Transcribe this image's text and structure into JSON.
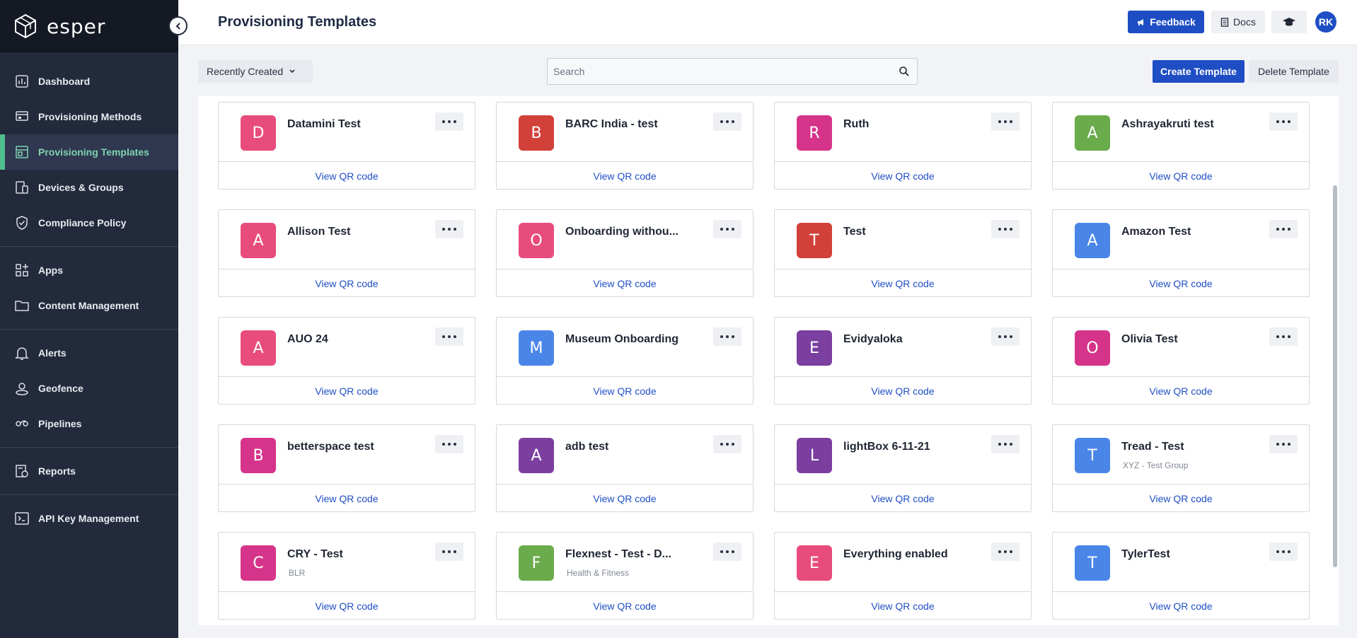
{
  "app": {
    "brand": "esper"
  },
  "sidebar": {
    "groups": [
      [
        {
          "label": "Dashboard",
          "icon": "dashboard-icon"
        },
        {
          "label": "Provisioning Methods",
          "icon": "provisioning-methods-icon"
        },
        {
          "label": "Provisioning Templates",
          "icon": "provisioning-templates-icon",
          "active": true
        },
        {
          "label": "Devices & Groups",
          "icon": "devices-icon"
        },
        {
          "label": "Compliance Policy",
          "icon": "shield-icon"
        }
      ],
      [
        {
          "label": "Apps",
          "icon": "apps-icon"
        },
        {
          "label": "Content Management",
          "icon": "folder-icon"
        }
      ],
      [
        {
          "label": "Alerts",
          "icon": "bell-icon"
        },
        {
          "label": "Geofence",
          "icon": "geofence-icon"
        },
        {
          "label": "Pipelines",
          "icon": "pipelines-icon"
        }
      ],
      [
        {
          "label": "Reports",
          "icon": "reports-icon"
        }
      ],
      [
        {
          "label": "API Key Management",
          "icon": "terminal-icon"
        }
      ]
    ]
  },
  "header": {
    "title": "Provisioning Templates",
    "feedback_label": "Feedback",
    "docs_label": "Docs",
    "avatar_initials": "RK"
  },
  "toolbar": {
    "sort_label": "Recently Created",
    "search_placeholder": "Search",
    "create_label": "Create Template",
    "delete_label": "Delete Template"
  },
  "cards": [
    {
      "letter": "D",
      "name": "Datamini Test",
      "sub": "",
      "color": "#e84c7d",
      "link": "View QR code"
    },
    {
      "letter": "B",
      "name": "BARC India - test",
      "sub": "",
      "color": "#d1413a",
      "link": "View QR code"
    },
    {
      "letter": "R",
      "name": "Ruth",
      "sub": "",
      "color": "#d6348a",
      "link": "View QR code"
    },
    {
      "letter": "A",
      "name": "Ashrayakruti test",
      "sub": "",
      "color": "#6aab4b",
      "link": "View QR code"
    },
    {
      "letter": "A",
      "name": "Allison Test",
      "sub": "",
      "color": "#e84c7d",
      "link": "View QR code"
    },
    {
      "letter": "O",
      "name": "Onboarding withou...",
      "sub": "",
      "color": "#e84c7d",
      "link": "View QR code"
    },
    {
      "letter": "T",
      "name": "Test",
      "sub": "",
      "color": "#d1413a",
      "link": "View QR code"
    },
    {
      "letter": "A",
      "name": "Amazon Test",
      "sub": "",
      "color": "#4a86e8",
      "link": "View QR code"
    },
    {
      "letter": "A",
      "name": "AUO 24",
      "sub": "",
      "color": "#e84c7d",
      "link": "View QR code"
    },
    {
      "letter": "M",
      "name": "Museum Onboarding",
      "sub": "",
      "color": "#4a86e8",
      "link": "View QR code"
    },
    {
      "letter": "E",
      "name": "Evidyaloka",
      "sub": "",
      "color": "#7b3fa0",
      "link": "View QR code"
    },
    {
      "letter": "O",
      "name": "Olivia Test",
      "sub": "",
      "color": "#d6348a",
      "link": "View QR code"
    },
    {
      "letter": "B",
      "name": "betterspace test",
      "sub": "",
      "color": "#d6348a",
      "link": "View QR code"
    },
    {
      "letter": "A",
      "name": "adb test",
      "sub": "",
      "color": "#7b3fa0",
      "link": "View QR code"
    },
    {
      "letter": "L",
      "name": "lightBox 6-11-21",
      "sub": "",
      "color": "#7b3fa0",
      "link": "View QR code"
    },
    {
      "letter": "T",
      "name": "Tread - Test",
      "sub": "XYZ - Test Group",
      "color": "#4a86e8",
      "link": "View QR code"
    },
    {
      "letter": "C",
      "name": "CRY - Test",
      "sub": "BLR",
      "color": "#d6348a",
      "link": "View QR code"
    },
    {
      "letter": "F",
      "name": "Flexnest - Test - D...",
      "sub": "Health & Fitness",
      "color": "#6aab4b",
      "link": "View QR code"
    },
    {
      "letter": "E",
      "name": "Everything enabled",
      "sub": "",
      "color": "#e84c7d",
      "link": "View QR code"
    },
    {
      "letter": "T",
      "name": "TylerTest",
      "sub": "",
      "color": "#4a86e8",
      "link": "View QR code"
    }
  ]
}
